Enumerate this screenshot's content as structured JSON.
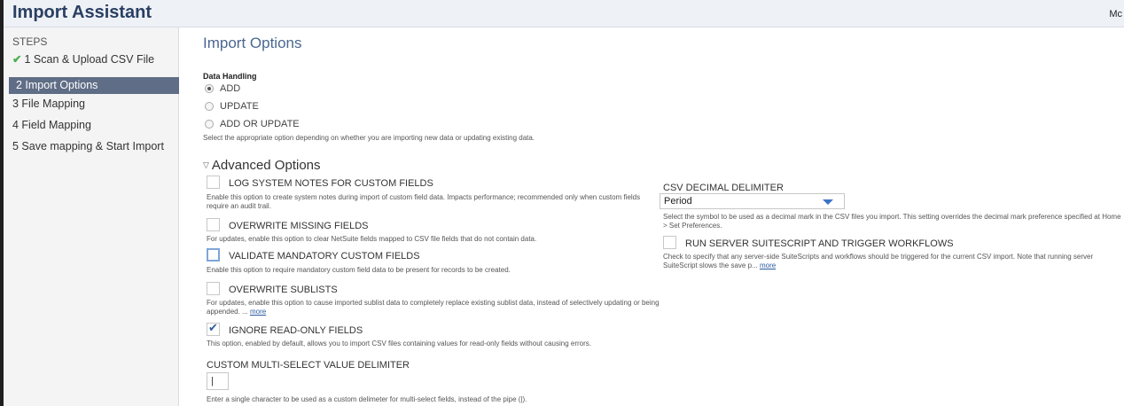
{
  "header": {
    "title": "Import Assistant",
    "right_text": "Mc"
  },
  "steps": {
    "title": "STEPS",
    "items": [
      {
        "label": "1 Scan & Upload CSV File",
        "done": true
      },
      {
        "label": "2 Import Options",
        "active": true
      },
      {
        "label": "3 File Mapping"
      },
      {
        "label": "4 Field Mapping"
      },
      {
        "label": "5 Save mapping & Start Import"
      }
    ]
  },
  "import_options": {
    "title": "Import Options",
    "data_handling": {
      "label": "Data Handling",
      "options": [
        "ADD",
        "UPDATE",
        "ADD OR UPDATE"
      ],
      "selected": "ADD",
      "help": "Select the appropriate option depending on whether you are importing new data or updating existing data."
    }
  },
  "advanced": {
    "title": "Advanced Options",
    "log_system_notes": {
      "label": "LOG SYSTEM NOTES FOR CUSTOM FIELDS",
      "checked": false,
      "help": "Enable this option to create system notes during import of custom field data. Impacts performance; recommended only when custom fields require an audit trail."
    },
    "overwrite_missing": {
      "label": "OVERWRITE MISSING FIELDS",
      "checked": false,
      "help": "For updates, enable this option to clear NetSuite fields mapped to CSV file fields that do not contain data."
    },
    "validate_mandatory": {
      "label": "VALIDATE MANDATORY CUSTOM FIELDS",
      "checked": false,
      "help": "Enable this option to require mandatory custom field data to be present for records to be created."
    },
    "overwrite_sublists": {
      "label": "OVERWRITE SUBLISTS",
      "checked": false,
      "help": "For updates, enable this option to cause imported sublist data to completely replace existing sublist data, instead of selectively updating or being appended. ...",
      "more": "more"
    },
    "ignore_readonly": {
      "label": "IGNORE READ-ONLY FIELDS",
      "checked": true,
      "help": "This option, enabled by default, allows you to import CSV files containing values for read-only fields without causing errors."
    },
    "multiselect_delimiter": {
      "label": "CUSTOM MULTI-SELECT VALUE DELIMITER",
      "value": "|",
      "help": "Enter a single character to be used as a custom delimeter for multi-select fields, instead of the pipe (|)."
    },
    "csv_decimal": {
      "label": "CSV DECIMAL DELIMITER",
      "value": "Period",
      "help": "Select the symbol to be used as a decimal mark in the CSV files you import. This setting overrides the decimal mark preference specified at Home > Set Preferences."
    },
    "run_suitescript": {
      "label": "RUN SERVER SUITESCRIPT AND TRIGGER WORKFLOWS",
      "checked": false,
      "help": "Check to specify that any server-side SuiteScripts and workflows should be triggered for the current CSV import. Note that running server SuiteScript slows the save p...",
      "more": "more"
    }
  }
}
